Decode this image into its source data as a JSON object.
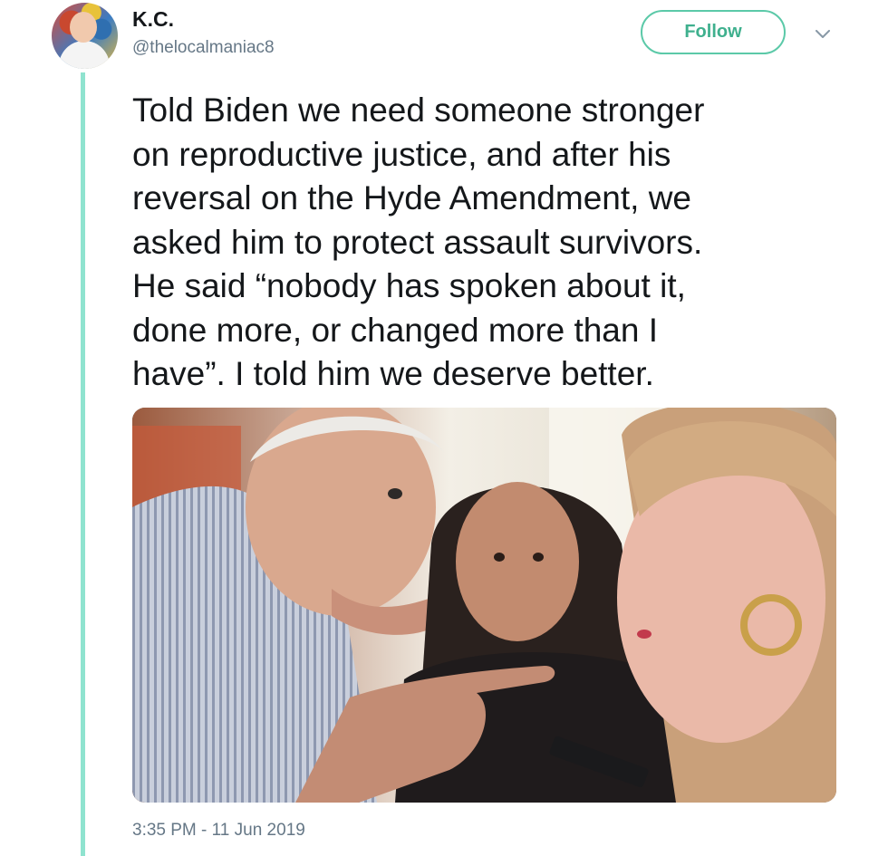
{
  "tweet": {
    "author": {
      "display_name": "K.C.",
      "handle": "@thelocalmaniac8",
      "avatar_icon": "profile-photo-avatar"
    },
    "follow_label": "Follow",
    "menu_icon": "chevron-down-icon",
    "text": "Told Biden we need someone stronger\non reproductive justice, and after his\nreversal on the Hyde Amendment, we\nasked him to protect assault survivors.\nHe said “nobody has spoken about it,\ndone more, or changed more than I\nhave”. I told him we deserve better.",
    "timestamp": "3:35 PM - 11 Jun 2019"
  },
  "colors": {
    "accent": "#5bc9a8",
    "thread_line": "#8fe3cf",
    "text_primary": "#14171a",
    "text_secondary": "#657786"
  }
}
